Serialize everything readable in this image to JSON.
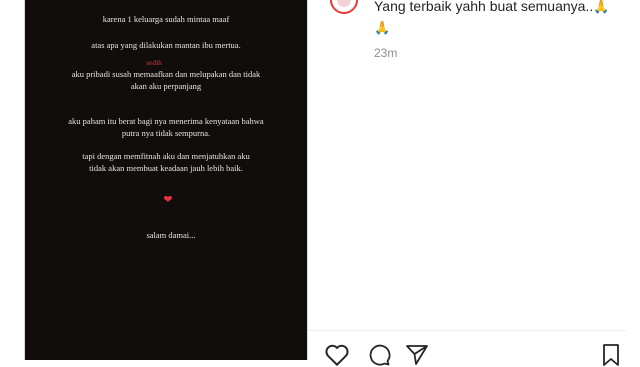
{
  "story": {
    "lines": [
      "karena 1 keluarga sudah mintaa maaf",
      "atas apa yang dilakukan mantan ibu mertua.",
      "sedih",
      "aku pribadi susah memaafkan dan melupakan dan tidak",
      "akan aku perpanjang",
      "aku paham itu berat bagi nya menerima kenyataan bahwa",
      "putra nya tidak sempurna.",
      "tapi dengan memfitnah aku dan menjatuhkan aku",
      "tidak akan membuat keadaan jauh lebih baik.",
      "salam damai..."
    ],
    "heart": "❤"
  },
  "post": {
    "caption": "Yang terbaik yahh buat semuanya..",
    "pray_emoji": "🙏",
    "time": "23m"
  },
  "actions": {
    "like_icon": "heart-outline-icon",
    "comment_icon": "comment-icon",
    "share_icon": "paper-plane-icon",
    "save_icon": "bookmark-icon"
  },
  "colors": {
    "story_bg": "#120d0d",
    "story_text": "#e8e3df",
    "highlight": "#c63b3b",
    "heart": "#e8303f"
  }
}
